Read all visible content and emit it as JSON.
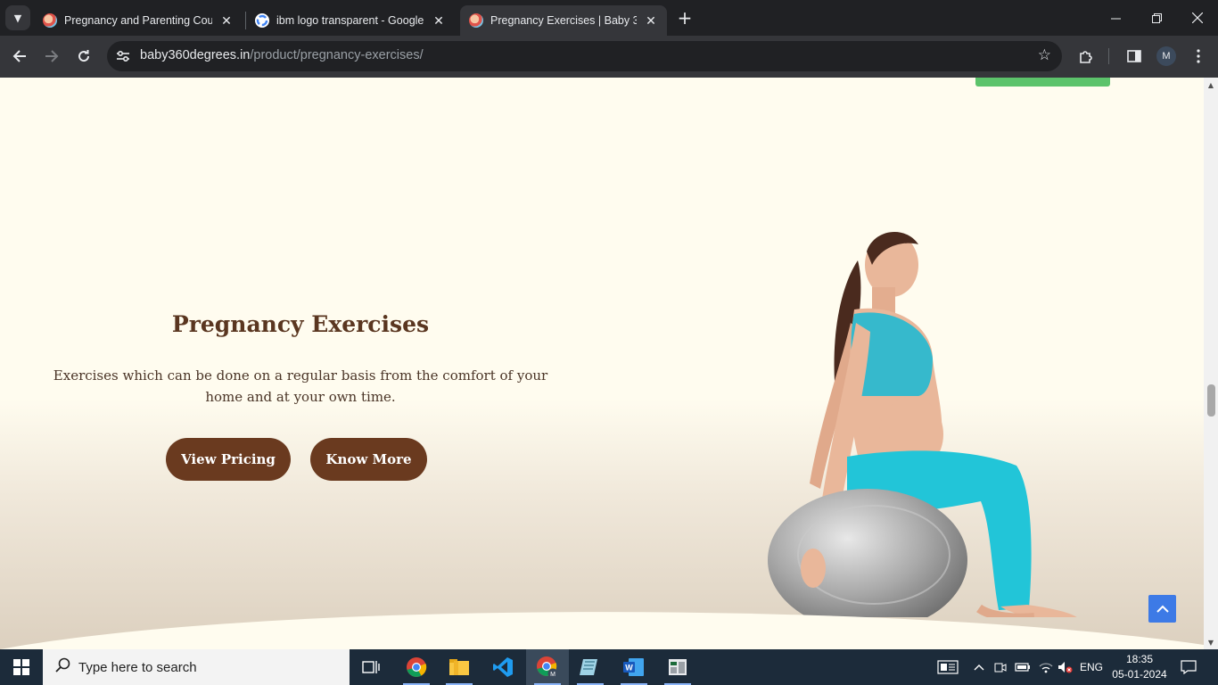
{
  "browser": {
    "tabs": [
      {
        "title": "Pregnancy and Parenting Cours",
        "active": false
      },
      {
        "title": "ibm logo transparent - Google",
        "active": false
      },
      {
        "title": "Pregnancy Exercises | Baby 360",
        "active": true
      }
    ],
    "url_host": "baby360degrees.in",
    "url_path": "/product/pregnancy-exercises/",
    "profile_initial": "M"
  },
  "page": {
    "title": "Pregnancy Exercises",
    "description": "Exercises which can be done on a regular basis from the comfort of your home and at your own time.",
    "buttons": {
      "view_pricing": "View Pricing",
      "know_more": "Know More"
    },
    "colors": {
      "background": "#fffcef",
      "button": "#6a3a1f",
      "title": "#5a3620",
      "accent_green": "#5cc36b",
      "scroll_top": "#3d7ae6"
    }
  },
  "taskbar": {
    "search_placeholder": "Type here to search",
    "language": "ENG",
    "time": "18:35",
    "date": "05-01-2024",
    "apps": [
      "task-view",
      "chrome",
      "file-explorer",
      "vscode",
      "chrome-profile-m",
      "notepad",
      "word",
      "spreadsheet"
    ]
  }
}
